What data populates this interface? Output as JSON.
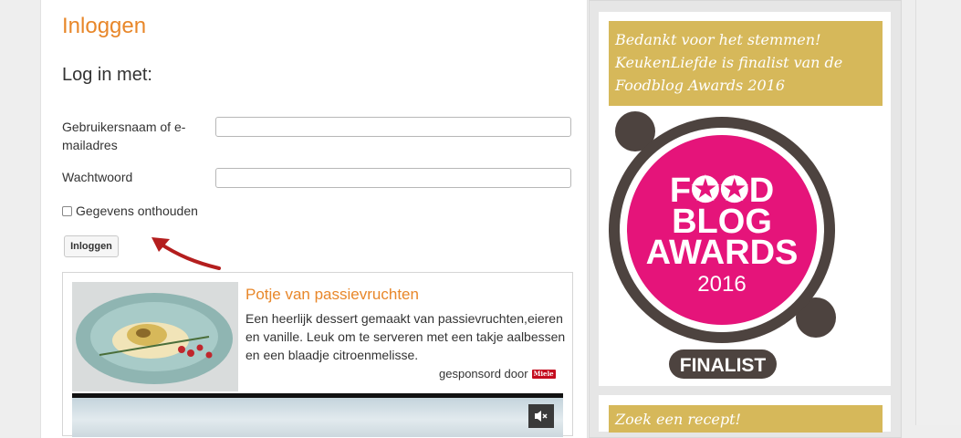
{
  "login": {
    "title": "Inloggen",
    "login_with": "Log in met:",
    "username_label": "Gebruikersnaam of e-mailadres",
    "username_value": "",
    "password_label": "Wachtwoord",
    "password_value": "",
    "remember_label": "Gegevens onthouden",
    "remember_checked": false,
    "submit_label": "Inloggen"
  },
  "recipe_ad": {
    "title": "Potje van passievruchten",
    "description": "Een heerlijk dessert gemaakt van passievruchten,eieren en vanille. Leuk om te serveren met een takje aalbessen en een blaadje citroenmelisse.",
    "sponsored": "gesponsord door",
    "sponsor_logo": "Miele",
    "mute_icon": "speaker-muted-icon"
  },
  "sidebar": {
    "award_banner": "Bedankt voor het stemmen! KeukenLiefde is finalist van de Foodblog Awards 2016",
    "badge": {
      "line1": "F✪✪D",
      "line2": "BLOG",
      "line3": "AWARDS",
      "year": "2016",
      "ribbon": "FINALIST"
    },
    "search_banner": "Zoek een recept!"
  },
  "colors": {
    "accent_orange": "#e8872a",
    "banner_gold": "#d6b85a",
    "badge_pink": "#e5147a",
    "badge_brown": "#4d433f",
    "arrow_red": "#b41e1e"
  }
}
